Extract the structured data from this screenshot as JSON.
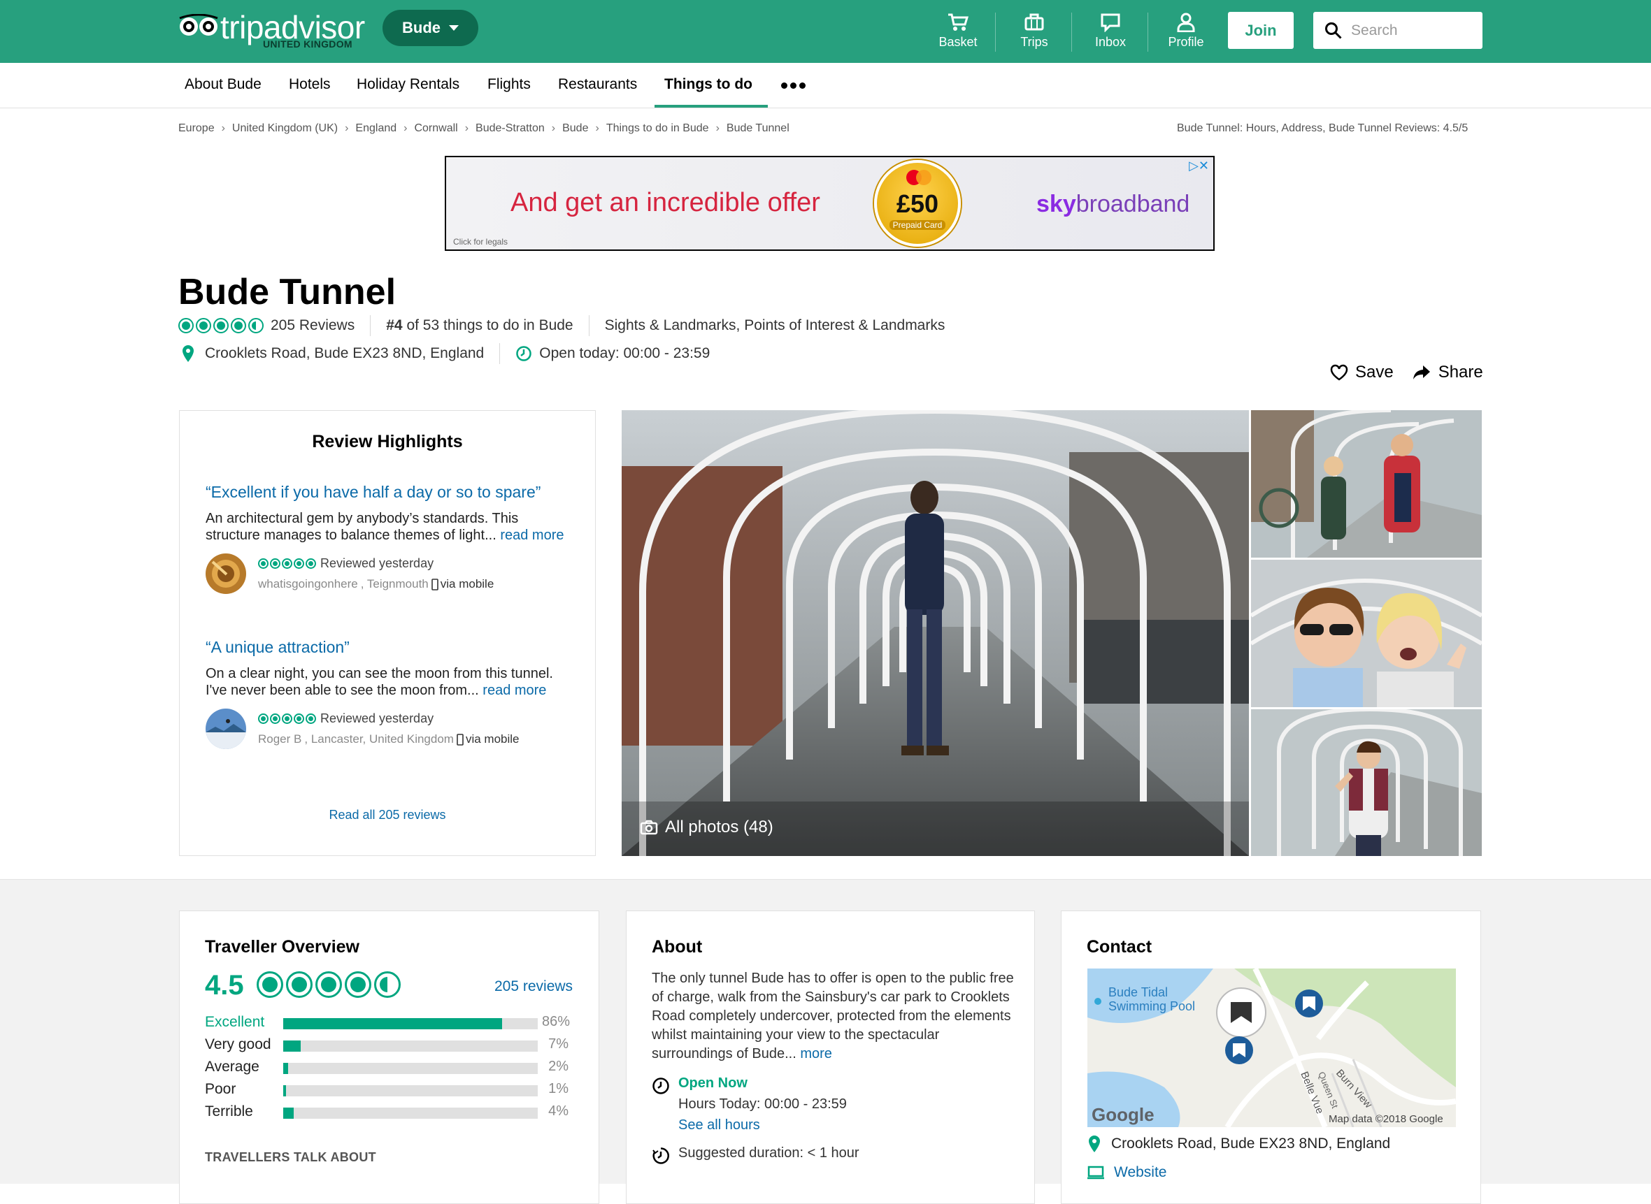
{
  "header": {
    "logo_text": "tripadvisor",
    "logo_sub": "UNITED KINGDOM",
    "location_button": "Bude",
    "nav": [
      {
        "label": "Basket",
        "icon": "basket-icon"
      },
      {
        "label": "Trips",
        "icon": "trips-icon"
      },
      {
        "label": "Inbox",
        "icon": "inbox-icon"
      },
      {
        "label": "Profile",
        "icon": "profile-icon"
      }
    ],
    "join_label": "Join",
    "search_placeholder": "Search",
    "colors": {
      "brand": "#27a07e",
      "pill": "#0e6a4f",
      "link": "#0b6aa8",
      "bubble": "#00a680"
    }
  },
  "subnav": {
    "items": [
      "About Bude",
      "Hotels",
      "Holiday Rentals",
      "Flights",
      "Restaurants",
      "Things to do"
    ],
    "active": "Things to do"
  },
  "breadcrumb": {
    "items": [
      "Europe",
      "United Kingdom (UK)",
      "England",
      "Cornwall",
      "Bude-Stratton",
      "Bude",
      "Things to do in Bude",
      "Bude Tunnel"
    ],
    "right": "Bude Tunnel: Hours, Address, Bude Tunnel Reviews: 4.5/5"
  },
  "ad": {
    "headline": "And get an incredible offer",
    "card_brand": "mastercard",
    "card_amount": "£50",
    "card_label": "Prepaid Card",
    "brand_sky": "sky",
    "brand_rest": "broadband",
    "legal": "Click for legals"
  },
  "attraction": {
    "name": "Bude Tunnel",
    "rating": 4.5,
    "reviews_label": "205 Reviews",
    "rank_num": "#4",
    "rank_rest": "of 53 things to do in Bude",
    "categories": "Sights & Landmarks, Points of Interest & Landmarks",
    "address": "Crooklets Road, Bude EX23 8ND, England",
    "open_today": "Open today: 00:00 - 23:59",
    "save_label": "Save",
    "share_label": "Share"
  },
  "highlights": {
    "title": "Review Highlights",
    "reviews": [
      {
        "quote": "“Excellent if you have half a day or so to spare”",
        "body": "An architectural gem by anybody’s standards. This structure manages to balance themes of light...",
        "more": "read more",
        "rating": 5,
        "reviewed": "Reviewed yesterday",
        "user": "whatisgoingonhere",
        "location": ", Teignmouth",
        "device": "via mobile"
      },
      {
        "quote": "“A unique attraction”",
        "body": "On a clear night, you can see the moon from this tunnel. I've never been able to see the moon from...",
        "more": "read more",
        "rating": 5,
        "reviewed": "Reviewed yesterday",
        "user": "Roger B",
        "location": ", Lancaster, United Kingdom",
        "device": "via mobile"
      }
    ],
    "read_all": "Read all 205 reviews"
  },
  "photos": {
    "all_label": "All photos (48)"
  },
  "overview": {
    "title": "Traveller Overview",
    "score": "4.5",
    "count_label": "205 reviews",
    "bars": [
      {
        "label": "Excellent",
        "pct_value": 0.86,
        "pct": "86%"
      },
      {
        "label": "Very good",
        "pct_value": 0.07,
        "pct": "7%"
      },
      {
        "label": "Average",
        "pct_value": 0.02,
        "pct": "2%"
      },
      {
        "label": "Poor",
        "pct_value": 0.01,
        "pct": "1%"
      },
      {
        "label": "Terrible",
        "pct_value": 0.04,
        "pct": "4%"
      }
    ],
    "talk_about": "TRAVELLERS TALK ABOUT"
  },
  "about": {
    "title": "About",
    "body": "The only tunnel Bude has to offer is open to the public free of charge, walk from the Sainsbury's car park to Crooklets Road completely undercover, protected from the elements whilst maintaining your view to the spectacular surroundings of Bude...",
    "more": "more",
    "open_now": "Open Now",
    "hours_today": "Hours Today: 00:00 - 23:59",
    "see_all": "See all hours",
    "duration": "Suggested duration: < 1 hour"
  },
  "contact": {
    "title": "Contact",
    "map_label_pool": "Bude Tidal\nSwimming Pool",
    "map_street_1": "Burn View",
    "map_street_2": "Belle Vue",
    "map_street_3": "Queen St",
    "map_copyright": "Map data ©2018 Google",
    "map_logo": "Google",
    "address": "Crooklets Road, Bude EX23 8ND, England",
    "website": "Website"
  }
}
